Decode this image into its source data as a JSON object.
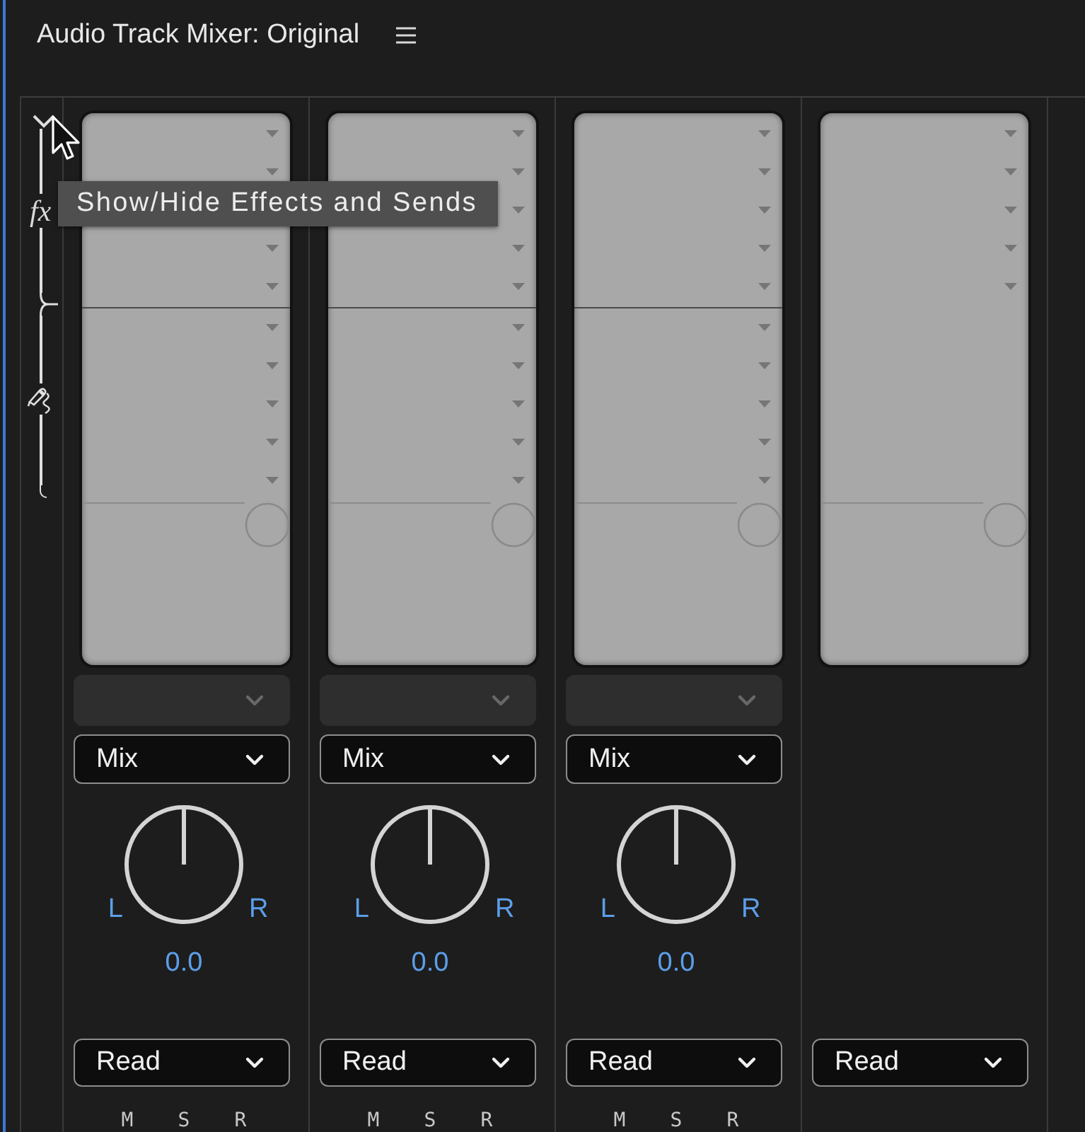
{
  "panel": {
    "title": "Audio Track Mixer: Original"
  },
  "sidebar": {
    "effects_expanded": true,
    "effects_label": "fx"
  },
  "tooltip": {
    "text": "Show/Hide Effects and Sends"
  },
  "tracks": [
    {
      "kind": "track",
      "output": {
        "disabled": true
      },
      "mode": "Mix",
      "pan": {
        "left": "L",
        "right": "R",
        "reading": "0.0"
      },
      "automation": "Read",
      "buttons": [
        "M",
        "S",
        "R"
      ]
    },
    {
      "kind": "track",
      "output": {
        "disabled": true
      },
      "mode": "Mix",
      "pan": {
        "left": "L",
        "right": "R",
        "reading": "0.0"
      },
      "automation": "Read",
      "buttons": [
        "M",
        "S",
        "R"
      ]
    },
    {
      "kind": "track",
      "output": {
        "disabled": true
      },
      "mode": "Mix",
      "pan": {
        "left": "L",
        "right": "R",
        "reading": "0.0"
      },
      "automation": "Read",
      "buttons": [
        "M",
        "S",
        "R"
      ]
    },
    {
      "kind": "master",
      "automation": "Read"
    }
  ]
}
